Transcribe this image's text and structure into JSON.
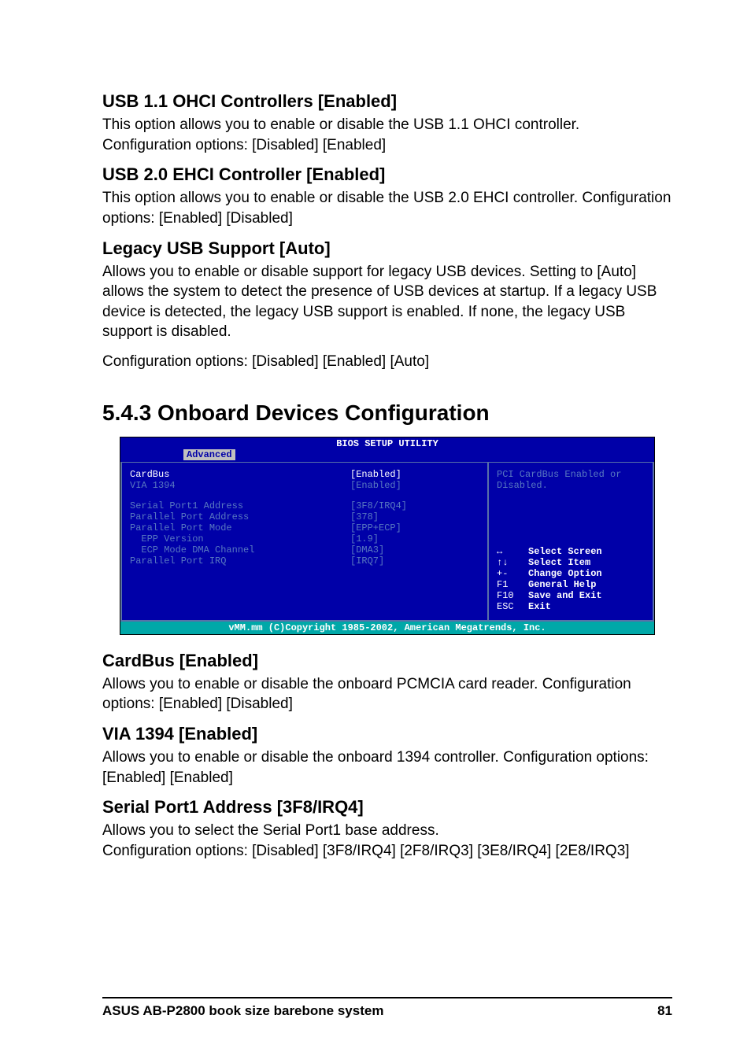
{
  "sections": {
    "usb11": {
      "heading": "USB 1.1 OHCI Controllers [Enabled]",
      "p1": "This option allows you to enable or disable the USB 1.1 OHCI controller. Configuration options: [Disabled] [Enabled]"
    },
    "usb20": {
      "heading": "USB 2.0 EHCI Controller [Enabled]",
      "p1": "This option allows you to enable or disable the USB 2.0 EHCI controller. Configuration options: [Enabled] [Disabled]"
    },
    "legacy": {
      "heading": "Legacy USB Support [Auto]",
      "p1": "Allows you to enable or disable support for legacy USB devices. Setting to [Auto] allows the system to detect the presence of USB devices at startup. If a legacy USB device is detected, the legacy USB support is enabled. If none, the legacy USB support is disabled.",
      "p2": "Configuration options: [Disabled] [Enabled] [Auto]"
    },
    "onboard": {
      "heading": "5.4.3  Onboard Devices Configuration"
    },
    "cardbus": {
      "heading": "CardBus [Enabled]",
      "p1": "Allows you to enable or disable the onboard PCMCIA card reader. Configuration options: [Enabled] [Disabled]"
    },
    "via1394": {
      "heading": "VIA 1394 [Enabled]",
      "p1": "Allows you to enable or disable the onboard 1394 controller. Configuration options: [Enabled] [Enabled]"
    },
    "serial": {
      "heading": "Serial Port1 Address [3F8/IRQ4]",
      "p1": "Allows you to select the Serial Port1 base address.",
      "p2": "Configuration options: [Disabled] [3F8/IRQ4] [2F8/IRQ3] [3E8/IRQ4] [2E8/IRQ3]"
    }
  },
  "bios": {
    "title": "BIOS SETUP UTILITY",
    "tab": "Advanced",
    "rows": {
      "r0": {
        "label": "CardBus",
        "val": "[Enabled]"
      },
      "r1": {
        "label": "VIA 1394",
        "val": "[Enabled]"
      },
      "r2": {
        "label": "Serial Port1 Address",
        "val": "[3F8/IRQ4]"
      },
      "r3": {
        "label": "Parallel Port Address",
        "val": "[378]"
      },
      "r4": {
        "label": "Parallel Port Mode",
        "val": "[EPP+ECP]"
      },
      "r5": {
        "label": "  EPP Version",
        "val": "[1.9]"
      },
      "r6": {
        "label": "  ECP Mode DMA Channel",
        "val": "[DMA3]"
      },
      "r7": {
        "label": "Parallel Port IRQ",
        "val": "[IRQ7]"
      }
    },
    "help": "PCI CardBus Enabled or Disabled.",
    "keys": {
      "k0": {
        "k": "↔",
        "d": "Select Screen"
      },
      "k1": {
        "k": "↑↓",
        "d": "Select Item"
      },
      "k2": {
        "k": "+-",
        "d": "Change Option"
      },
      "k3": {
        "k": "F1",
        "d": "General Help"
      },
      "k4": {
        "k": "F10",
        "d": "Save and Exit"
      },
      "k5": {
        "k": "ESC",
        "d": "Exit"
      }
    },
    "footer": "vMM.mm (C)Copyright 1985-2002, American Megatrends, Inc."
  },
  "footer": {
    "left": "ASUS AB-P2800 book size barebone system",
    "right": "81"
  }
}
